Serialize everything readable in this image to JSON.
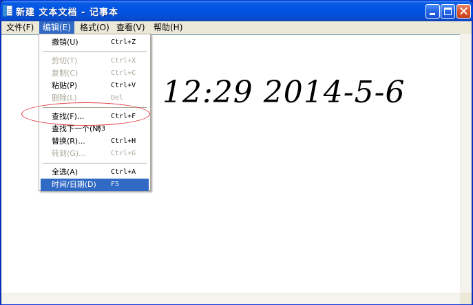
{
  "window": {
    "title": "新建 文本文档 - 记事本",
    "icon": "notepad-icon"
  },
  "titlebar_buttons": {
    "minimize": "minimize-icon",
    "maximize": "maximize-icon",
    "close": "close-icon"
  },
  "menubar": {
    "items": [
      {
        "label": "文件(F)",
        "name": "file"
      },
      {
        "label": "编辑(E)",
        "name": "edit",
        "active": true
      },
      {
        "label": "格式(O)",
        "name": "format"
      },
      {
        "label": "查看(V)",
        "name": "view"
      },
      {
        "label": "帮助(H)",
        "name": "help"
      }
    ]
  },
  "edit_menu": {
    "items": [
      {
        "label": "撤销(U)",
        "shortcut": "Ctrl+Z",
        "enabled": true
      },
      {
        "label": "剪切(T)",
        "shortcut": "Ctrl+X",
        "enabled": false
      },
      {
        "label": "复制(C)",
        "shortcut": "Ctrl+C",
        "enabled": false
      },
      {
        "label": "粘贴(P)",
        "shortcut": "Ctrl+V",
        "enabled": true
      },
      {
        "label": "删除(L)",
        "shortcut": "Del",
        "enabled": false
      },
      {
        "label": "查找(F)...",
        "shortcut": "Ctrl+F",
        "enabled": true
      },
      {
        "label": "查找下一个(N)",
        "shortcut": "F3",
        "enabled": true
      },
      {
        "label": "替换(R)...",
        "shortcut": "Ctrl+H",
        "enabled": true
      },
      {
        "label": "转到(G)...",
        "shortcut": "Ctrl+G",
        "enabled": false
      },
      {
        "label": "全选(A)",
        "shortcut": "Ctrl+A",
        "enabled": true
      },
      {
        "label": "时间/日期(D)",
        "shortcut": "F5",
        "enabled": true,
        "highlighted": true
      }
    ]
  },
  "editor": {
    "content": "12:29 2014-5-6"
  },
  "colors": {
    "titlebar": "#0055e5",
    "menu_highlight": "#316ac5",
    "annotation": "#e0383e",
    "disabled_text": "#aca899"
  }
}
